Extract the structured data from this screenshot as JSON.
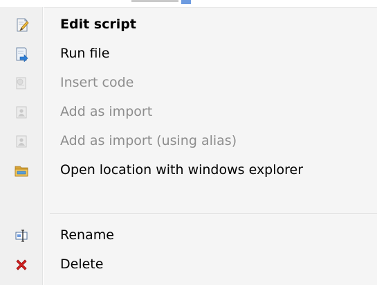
{
  "menu": {
    "items": [
      {
        "label": "Edit script",
        "icon": "edit-script-icon"
      },
      {
        "label": "Run file",
        "icon": "run-file-icon"
      },
      {
        "label": "Insert code",
        "icon": "insert-code-icon"
      },
      {
        "label": "Add as import",
        "icon": "add-import-icon"
      },
      {
        "label": "Add as import (using alias)",
        "icon": "add-import-alias-icon"
      },
      {
        "label": "Open location with windows explorer",
        "icon": "folder-icon"
      },
      {
        "label": "Rename",
        "icon": "rename-icon"
      },
      {
        "label": "Delete",
        "icon": "delete-icon"
      }
    ]
  },
  "colors": {
    "menu_background": "#f5f5f5",
    "disabled_text": "#8d8d8d",
    "delete_icon": "#d21f1f",
    "folder_icon": "#e8b84a"
  }
}
